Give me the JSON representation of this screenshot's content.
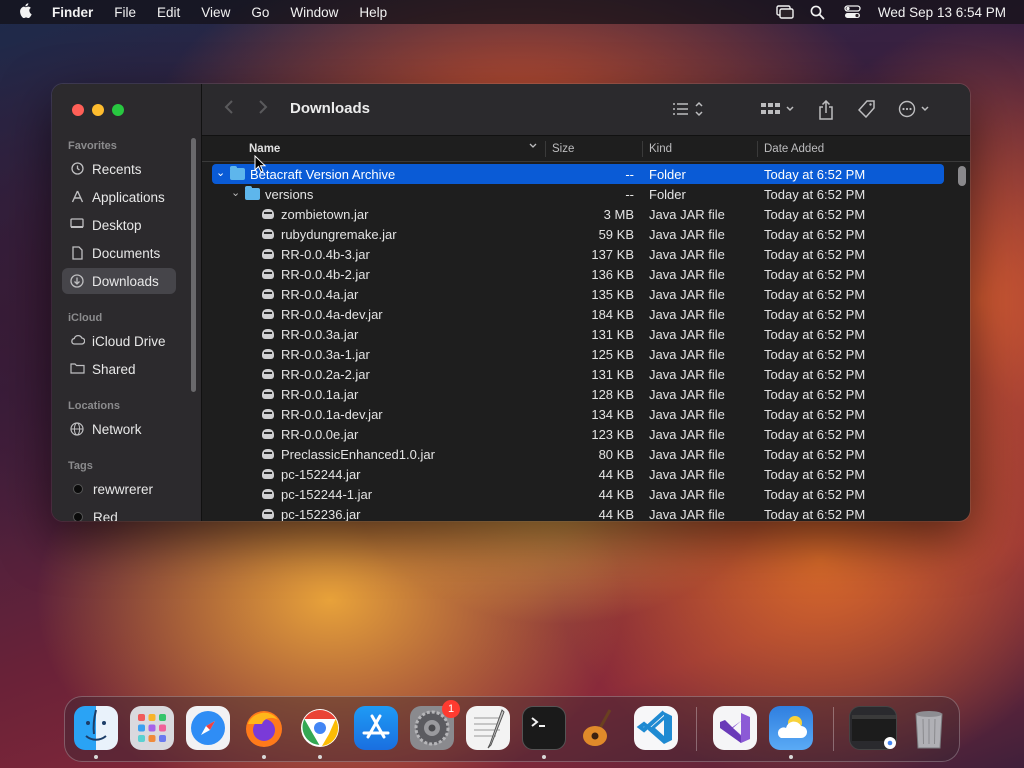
{
  "menubar": {
    "app": "Finder",
    "menus": [
      "File",
      "Edit",
      "View",
      "Go",
      "Window",
      "Help"
    ],
    "clock": "Wed Sep 13  6:54 PM"
  },
  "window": {
    "title": "Downloads",
    "sidebar": {
      "favorites_label": "Favorites",
      "favorites": [
        "Recents",
        "Applications",
        "Desktop",
        "Documents",
        "Downloads"
      ],
      "icloud_label": "iCloud",
      "icloud": [
        "iCloud Drive",
        "Shared"
      ],
      "locations_label": "Locations",
      "locations": [
        "Network"
      ],
      "tags_label": "Tags",
      "tags": [
        "rewwrerer",
        "Red"
      ]
    },
    "columns": {
      "name": "Name",
      "size": "Size",
      "kind": "Kind",
      "date": "Date Added"
    },
    "rows": [
      {
        "name": "Betacraft Version Archive",
        "size": "--",
        "kind": "Folder",
        "date": "Today at 6:52 PM"
      },
      {
        "name": "versions",
        "size": "--",
        "kind": "Folder",
        "date": "Today at 6:52 PM"
      },
      {
        "name": "zombietown.jar",
        "size": "3 MB",
        "kind": "Java JAR file",
        "date": "Today at 6:52 PM"
      },
      {
        "name": "rubydungremake.jar",
        "size": "59 KB",
        "kind": "Java JAR file",
        "date": "Today at 6:52 PM"
      },
      {
        "name": "RR-0.0.4b-3.jar",
        "size": "137 KB",
        "kind": "Java JAR file",
        "date": "Today at 6:52 PM"
      },
      {
        "name": "RR-0.0.4b-2.jar",
        "size": "136 KB",
        "kind": "Java JAR file",
        "date": "Today at 6:52 PM"
      },
      {
        "name": "RR-0.0.4a.jar",
        "size": "135 KB",
        "kind": "Java JAR file",
        "date": "Today at 6:52 PM"
      },
      {
        "name": "RR-0.0.4a-dev.jar",
        "size": "184 KB",
        "kind": "Java JAR file",
        "date": "Today at 6:52 PM"
      },
      {
        "name": "RR-0.0.3a.jar",
        "size": "131 KB",
        "kind": "Java JAR file",
        "date": "Today at 6:52 PM"
      },
      {
        "name": "RR-0.0.3a-1.jar",
        "size": "125 KB",
        "kind": "Java JAR file",
        "date": "Today at 6:52 PM"
      },
      {
        "name": "RR-0.0.2a-2.jar",
        "size": "131 KB",
        "kind": "Java JAR file",
        "date": "Today at 6:52 PM"
      },
      {
        "name": "RR-0.0.1a.jar",
        "size": "128 KB",
        "kind": "Java JAR file",
        "date": "Today at 6:52 PM"
      },
      {
        "name": "RR-0.0.1a-dev.jar",
        "size": "134 KB",
        "kind": "Java JAR file",
        "date": "Today at 6:52 PM"
      },
      {
        "name": "RR-0.0.0e.jar",
        "size": "123 KB",
        "kind": "Java JAR file",
        "date": "Today at 6:52 PM"
      },
      {
        "name": "PreclassicEnhanced1.0.jar",
        "size": "80 KB",
        "kind": "Java JAR file",
        "date": "Today at 6:52 PM"
      },
      {
        "name": "pc-152244.jar",
        "size": "44 KB",
        "kind": "Java JAR file",
        "date": "Today at 6:52 PM"
      },
      {
        "name": "pc-152244-1.jar",
        "size": "44 KB",
        "kind": "Java JAR file",
        "date": "Today at 6:52 PM"
      },
      {
        "name": "pc-152236.jar",
        "size": "44 KB",
        "kind": "Java JAR file",
        "date": "Today at 6:52 PM"
      }
    ]
  },
  "dock": {
    "badge_settings": "1",
    "apps": [
      "finder-icon",
      "launchpad-icon",
      "safari-icon",
      "firefox-icon",
      "chrome-icon",
      "app-store-icon",
      "system-settings-icon",
      "textedit-icon",
      "terminal-icon",
      "garageband-icon",
      "vscode-icon",
      "visual-studio-icon",
      "weather-icon",
      "minimized-window-icon",
      "trash-icon"
    ]
  },
  "colors": {
    "selection": "#0a5bd6",
    "folder": "#5eb6ec"
  }
}
